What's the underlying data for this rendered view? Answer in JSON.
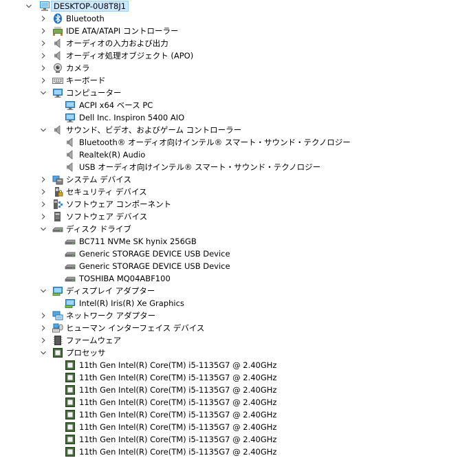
{
  "root": {
    "label": "DESKTOP-0U8T8J1",
    "expanded": true,
    "icon": "computer-icon"
  },
  "nodes": [
    {
      "label": "Bluetooth",
      "level": 1,
      "expanded": false,
      "icon": "bluetooth-icon"
    },
    {
      "label": "IDE ATA/ATAPI コントローラー",
      "level": 1,
      "expanded": false,
      "icon": "ide-controller-icon"
    },
    {
      "label": "オーディオの入力および出力",
      "level": 1,
      "expanded": false,
      "icon": "speaker-icon"
    },
    {
      "label": "オーディオ処理オブジェクト (APO)",
      "level": 1,
      "expanded": false,
      "icon": "speaker-icon"
    },
    {
      "label": "カメラ",
      "level": 1,
      "expanded": false,
      "icon": "camera-icon"
    },
    {
      "label": "キーボード",
      "level": 1,
      "expanded": false,
      "icon": "keyboard-icon"
    },
    {
      "label": "コンピューター",
      "level": 1,
      "expanded": true,
      "icon": "monitor-icon"
    },
    {
      "label": "ACPI x64 ベース PC",
      "level": 2,
      "icon": "monitor-icon"
    },
    {
      "label": "Dell Inc. Inspiron 5400 AIO",
      "level": 2,
      "icon": "monitor-icon"
    },
    {
      "label": "サウンド、ビデオ、およびゲーム コントローラー",
      "level": 1,
      "expanded": true,
      "icon": "speaker-icon"
    },
    {
      "label": "Bluetooth® オーディオ向けインテル® スマート・サウンド・テクノロジー",
      "level": 2,
      "icon": "speaker-icon"
    },
    {
      "label": "Realtek(R) Audio",
      "level": 2,
      "icon": "speaker-icon"
    },
    {
      "label": "USB オーディオ向けインテル® スマート・サウンド・テクノロジー",
      "level": 2,
      "icon": "speaker-icon"
    },
    {
      "label": "システム デバイス",
      "level": 1,
      "expanded": false,
      "icon": "system-devices-icon"
    },
    {
      "label": "セキュリティ デバイス",
      "level": 1,
      "expanded": false,
      "icon": "security-device-icon"
    },
    {
      "label": "ソフトウェア コンポーネント",
      "level": 1,
      "expanded": false,
      "icon": "software-component-icon"
    },
    {
      "label": "ソフトウェア デバイス",
      "level": 1,
      "expanded": false,
      "icon": "software-device-icon"
    },
    {
      "label": "ディスク ドライブ",
      "level": 1,
      "expanded": true,
      "icon": "disk-drive-icon"
    },
    {
      "label": "BC711 NVMe SK hynix 256GB",
      "level": 2,
      "icon": "disk-drive-icon"
    },
    {
      "label": "Generic STORAGE DEVICE USB Device",
      "level": 2,
      "icon": "disk-drive-icon"
    },
    {
      "label": "Generic STORAGE DEVICE USB Device",
      "level": 2,
      "icon": "disk-drive-icon"
    },
    {
      "label": "TOSHIBA MQ04ABF100",
      "level": 2,
      "icon": "disk-drive-icon"
    },
    {
      "label": "ディスプレイ アダプター",
      "level": 1,
      "expanded": true,
      "icon": "display-adapter-icon"
    },
    {
      "label": "Intel(R) Iris(R) Xe Graphics",
      "level": 2,
      "icon": "display-adapter-icon"
    },
    {
      "label": "ネットワーク アダプター",
      "level": 1,
      "expanded": false,
      "icon": "network-adapter-icon"
    },
    {
      "label": "ヒューマン インターフェイス デバイス",
      "level": 1,
      "expanded": false,
      "icon": "hid-icon"
    },
    {
      "label": "ファームウェア",
      "level": 1,
      "expanded": false,
      "icon": "firmware-icon"
    },
    {
      "label": "プロセッサ",
      "level": 1,
      "expanded": true,
      "icon": "processor-icon"
    },
    {
      "label": "11th Gen Intel(R) Core(TM) i5-1135G7 @ 2.40GHz",
      "level": 2,
      "icon": "processor-icon"
    },
    {
      "label": "11th Gen Intel(R) Core(TM) i5-1135G7 @ 2.40GHz",
      "level": 2,
      "icon": "processor-icon"
    },
    {
      "label": "11th Gen Intel(R) Core(TM) i5-1135G7 @ 2.40GHz",
      "level": 2,
      "icon": "processor-icon"
    },
    {
      "label": "11th Gen Intel(R) Core(TM) i5-1135G7 @ 2.40GHz",
      "level": 2,
      "icon": "processor-icon"
    },
    {
      "label": "11th Gen Intel(R) Core(TM) i5-1135G7 @ 2.40GHz",
      "level": 2,
      "icon": "processor-icon"
    },
    {
      "label": "11th Gen Intel(R) Core(TM) i5-1135G7 @ 2.40GHz",
      "level": 2,
      "icon": "processor-icon"
    },
    {
      "label": "11th Gen Intel(R) Core(TM) i5-1135G7 @ 2.40GHz",
      "level": 2,
      "icon": "processor-icon"
    },
    {
      "label": "11th Gen Intel(R) Core(TM) i5-1135G7 @ 2.40GHz",
      "level": 2,
      "icon": "processor-icon"
    }
  ],
  "colors": {
    "selection_bg": "#cce8ff",
    "selection_border": "#99d1ff",
    "chevron": "#555555",
    "monitor_blue": "#2b8fd6",
    "processor_green": "#3a6b2a"
  }
}
